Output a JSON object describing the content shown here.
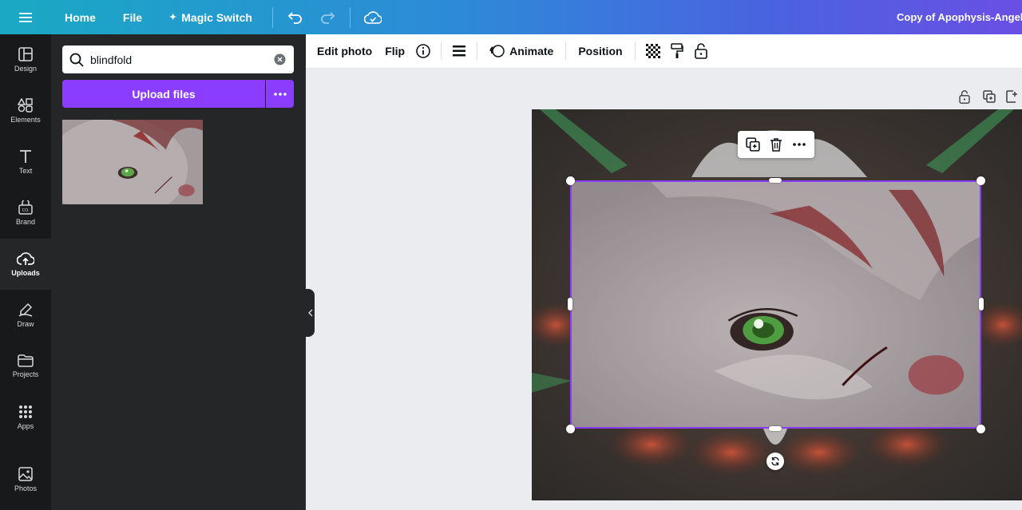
{
  "topbar": {
    "home_label": "Home",
    "file_label": "File",
    "magic_switch_label": "Magic Switch",
    "doc_title": "Copy of Apophysis-AngelC"
  },
  "rail": {
    "items": [
      {
        "label": "Design",
        "icon": "layout-icon"
      },
      {
        "label": "Elements",
        "icon": "shapes-icon"
      },
      {
        "label": "Text",
        "icon": "text-icon"
      },
      {
        "label": "Brand",
        "icon": "brand-icon"
      },
      {
        "label": "Uploads",
        "icon": "cloud-upload-icon",
        "active": true
      },
      {
        "label": "Draw",
        "icon": "pen-icon"
      },
      {
        "label": "Projects",
        "icon": "folder-icon"
      },
      {
        "label": "Apps",
        "icon": "grid-icon"
      },
      {
        "label": "Photos",
        "icon": "image-icon"
      }
    ]
  },
  "panel": {
    "search_value": "blindfold",
    "upload_label": "Upload files"
  },
  "toolbar": {
    "edit_photo_label": "Edit photo",
    "flip_label": "Flip",
    "animate_label": "Animate",
    "position_label": "Position"
  },
  "colors": {
    "accent": "#8b3dff",
    "rail_bg": "#18191b",
    "panel_bg": "#252627",
    "canvas_bg": "#ebecf0"
  }
}
